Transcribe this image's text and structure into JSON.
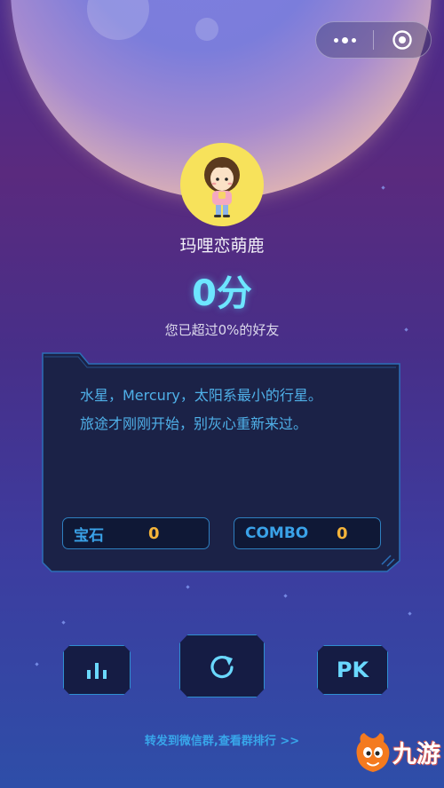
{
  "player": {
    "name": "玛哩恋萌鹿",
    "score": "0分",
    "rank_text": "您已超过0%的好友"
  },
  "info": {
    "line1": "水星，Mercury，太阳系最小的行星。",
    "line2": "旅途才刚刚开始，别灰心重新来过。"
  },
  "stats": {
    "gem_label": "宝石",
    "gem_value": "0",
    "combo_label": "COMBO",
    "combo_value": "0"
  },
  "buttons": {
    "pk_label": "PK",
    "left_icon": "bar-chart-icon",
    "center_icon": "restart-icon"
  },
  "share": {
    "text": "转发到微信群,查看群排行 >>"
  },
  "watermark": {
    "text": "九游"
  },
  "colors": {
    "score": "#6de6ff",
    "accent": "#4fb0e8",
    "stat_value": "#f5b43a"
  }
}
